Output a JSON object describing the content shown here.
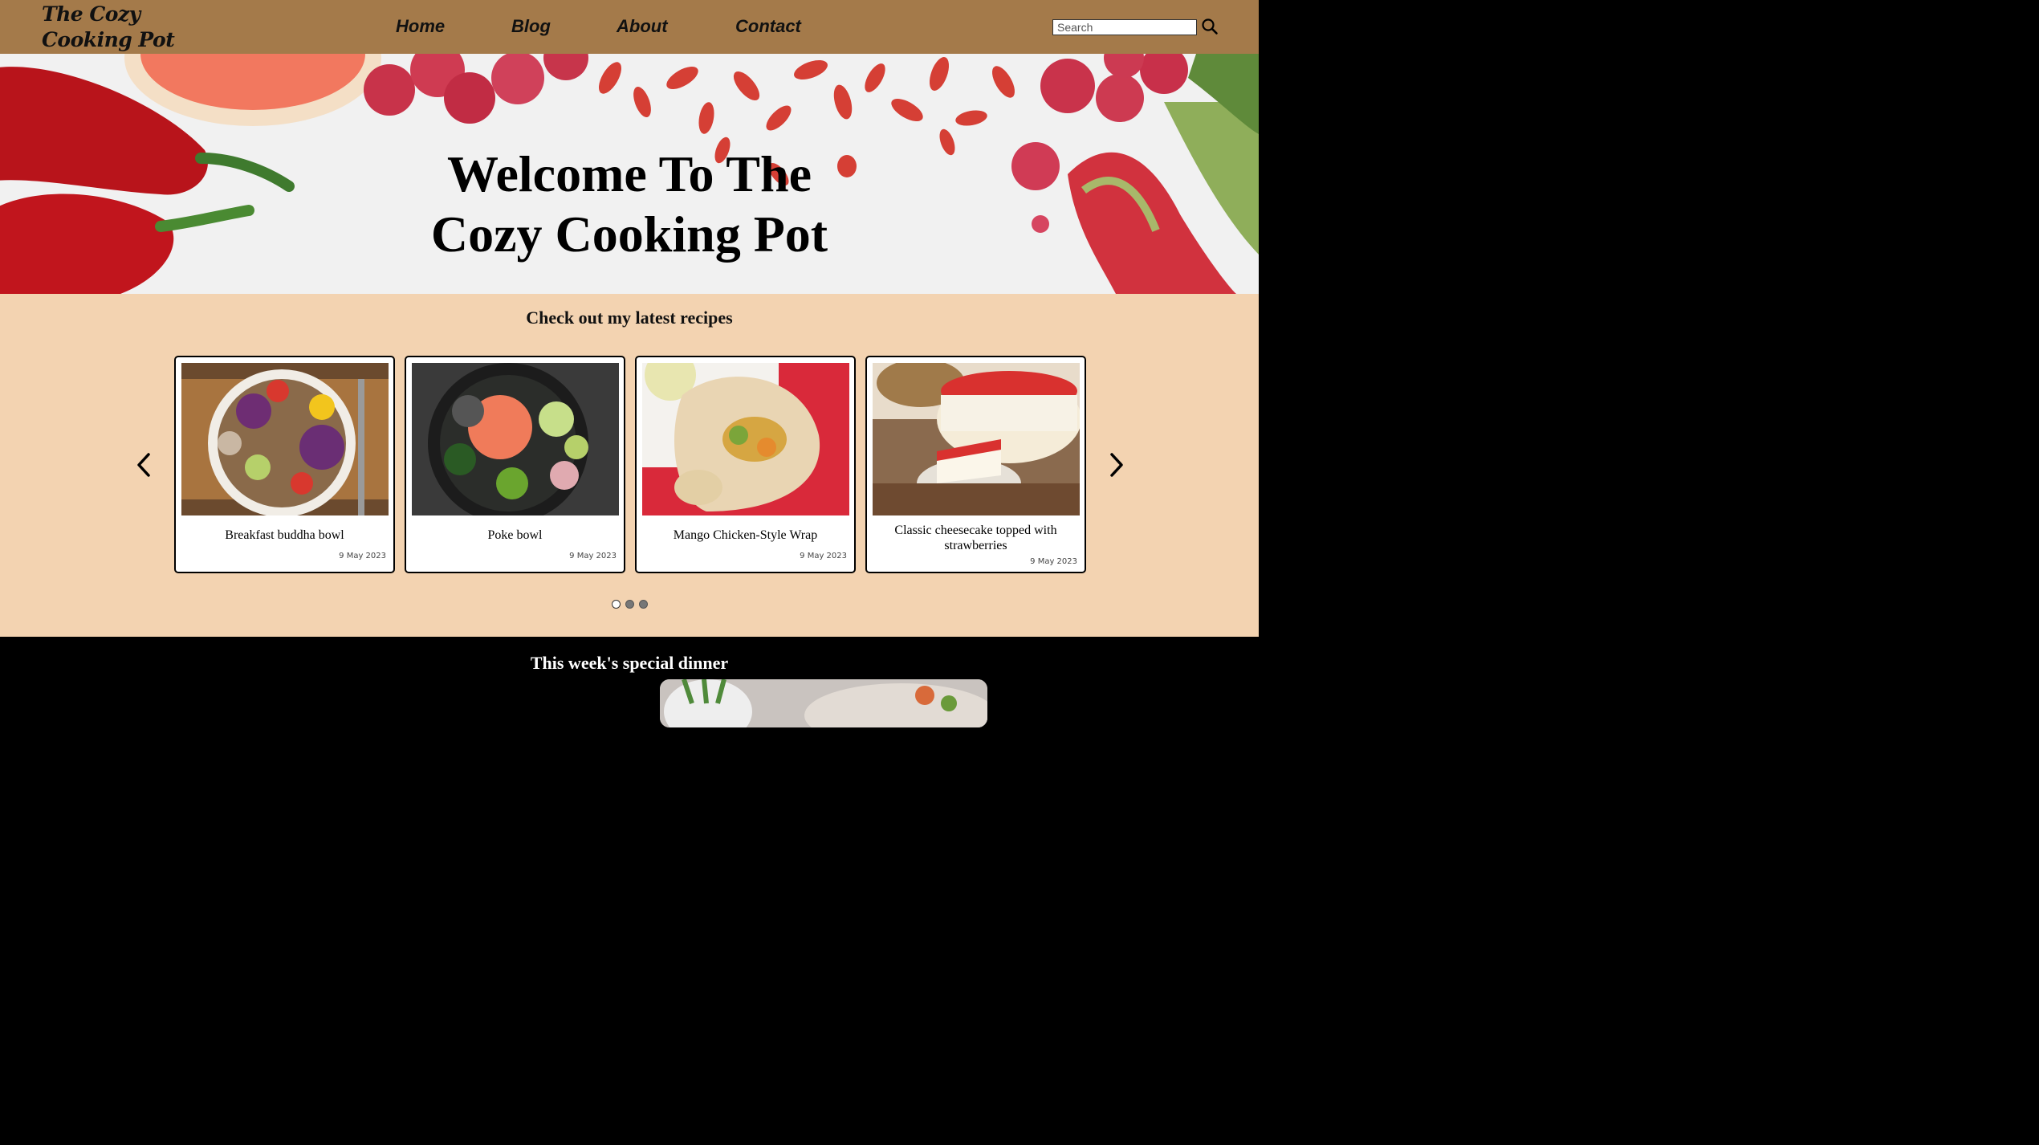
{
  "nav": {
    "logo_line1": "The Cozy",
    "logo_line2": "Cooking Pot",
    "links": [
      {
        "label": "Home"
      },
      {
        "label": "Blog"
      },
      {
        "label": "About"
      },
      {
        "label": "Contact"
      }
    ],
    "search": {
      "placeholder": "Search",
      "value": ""
    },
    "search_icon": "search-icon"
  },
  "hero": {
    "title_line1": "Welcome To The",
    "title_line2": "Cozy Cooking Pot"
  },
  "recipes": {
    "heading": "Check out my latest recipes",
    "cards": [
      {
        "title": "Breakfast buddha bowl",
        "date": "9 May 2023"
      },
      {
        "title": "Poke bowl",
        "date": "9 May 2023"
      },
      {
        "title": "Mango Chicken-Style Wrap",
        "date": "9 May 2023"
      },
      {
        "title": "Classic cheesecake topped with strawberries",
        "date": "9 May 2023"
      }
    ],
    "prev_icon": "chevron-left-icon",
    "next_icon": "chevron-right-icon",
    "pagination": {
      "pages": 3,
      "active": 1
    }
  },
  "special": {
    "heading": "This week's special dinner"
  },
  "colors": {
    "nav_bg": "#a47a4a",
    "recipes_bg": "#f3d3b1",
    "special_bg": "#000000"
  }
}
